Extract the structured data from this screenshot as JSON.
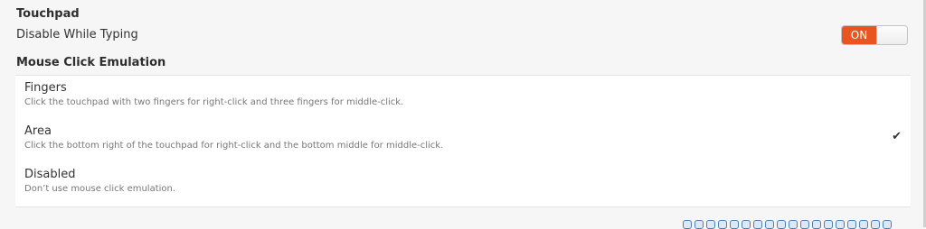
{
  "touchpad": {
    "title": "Touchpad",
    "disable_while_typing_label": "Disable While Typing",
    "toggle_state_label": "ON",
    "toggle_on": true,
    "accent_color": "#e95420"
  },
  "mouse_click_emulation": {
    "title": "Mouse Click Emulation",
    "selected": "Area",
    "check_icon": "checkmark-icon",
    "options": [
      {
        "name": "Fingers",
        "description": "Click the touchpad with two fingers for right-click and three fingers for middle-click."
      },
      {
        "name": "Area",
        "description": "Click the bottom right of the touchpad for right-click and the bottom middle for middle-click."
      },
      {
        "name": "Disabled",
        "description": "Don’t use mouse click emulation."
      }
    ]
  },
  "taskbar": {
    "icons": [
      "tray-icon",
      "tray-icon",
      "tray-icon",
      "tray-icon",
      "tray-icon",
      "tray-icon",
      "tray-icon",
      "tray-icon",
      "tray-icon",
      "tray-icon",
      "tray-icon",
      "tray-icon",
      "tray-icon",
      "tray-icon",
      "tray-icon",
      "tray-icon",
      "tray-icon",
      "tray-icon"
    ]
  }
}
